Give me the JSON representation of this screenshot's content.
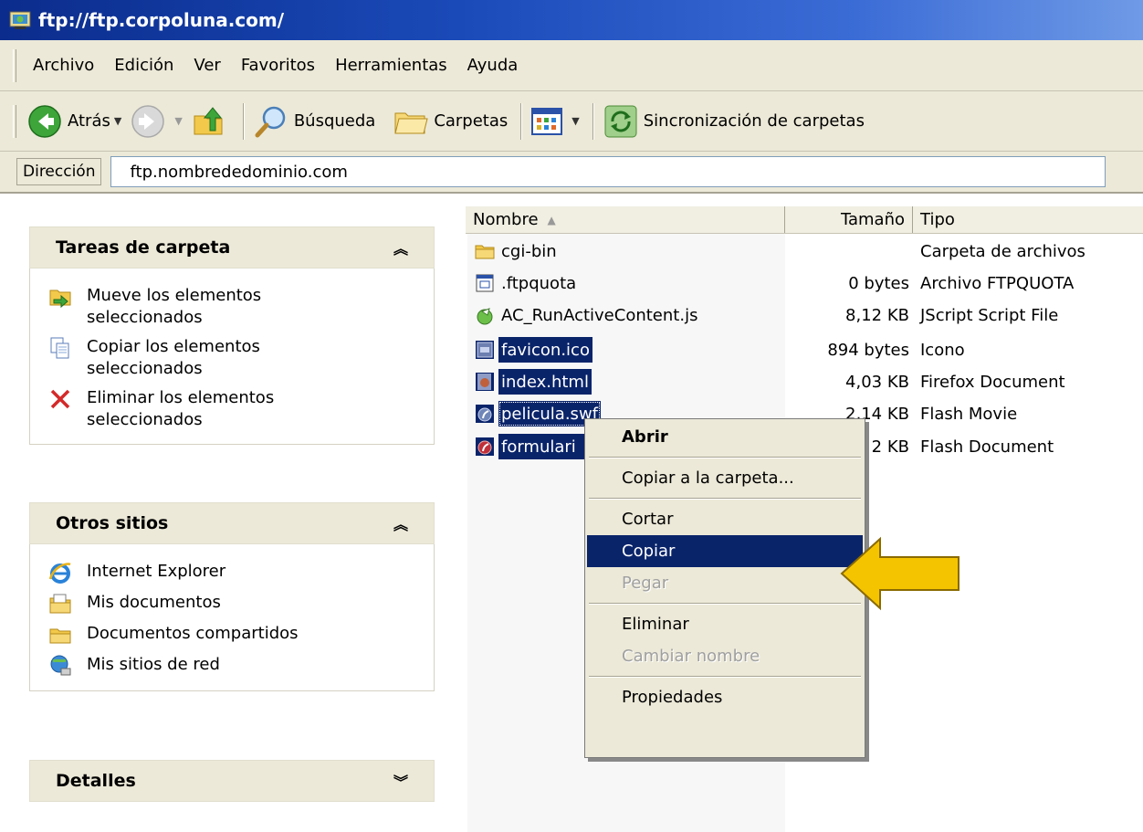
{
  "window": {
    "title": "ftp://ftp.corpoluna.com/"
  },
  "menubar": {
    "items": [
      "Archivo",
      "Edición",
      "Ver",
      "Favoritos",
      "Herramientas",
      "Ayuda"
    ]
  },
  "toolbar": {
    "back_label": "Atrás",
    "search_label": "Búsqueda",
    "folders_label": "Carpetas",
    "sync_label": "Sincronización de carpetas"
  },
  "address": {
    "label": "Dirección",
    "value": "ftp.nombrededominio.com"
  },
  "taskpane": {
    "folder_tasks": {
      "title": "Tareas de carpeta",
      "items": [
        {
          "line1": "Mueve los elementos",
          "line2": "seleccionados"
        },
        {
          "line1": "Copiar los elementos",
          "line2": "seleccionados"
        },
        {
          "line1": "Eliminar los elementos",
          "line2": "seleccionados"
        }
      ]
    },
    "other_places": {
      "title": "Otros sitios",
      "items": [
        "Internet Explorer",
        "Mis documentos",
        "Documentos compartidos",
        "Mis sitios de red"
      ]
    },
    "details": {
      "title": "Detalles"
    }
  },
  "filelist": {
    "columns": {
      "name": "Nombre",
      "size": "Tamaño",
      "type": "Tipo"
    },
    "rows": [
      {
        "name": "cgi-bin",
        "size": "",
        "type": "Carpeta de archivos",
        "selected": false
      },
      {
        "name": ".ftpquota",
        "size": "0 bytes",
        "type": "Archivo FTPQUOTA",
        "selected": false
      },
      {
        "name": "AC_RunActiveContent.js",
        "size": "8,12 KB",
        "type": "JScript Script File",
        "selected": false
      },
      {
        "name": "favicon.ico",
        "size": "894 bytes",
        "type": "Icono",
        "selected": true
      },
      {
        "name": "index.html",
        "size": "4,03 KB",
        "type": "Firefox Document",
        "selected": true
      },
      {
        "name": "pelicula.swf",
        "size": "2,14 KB",
        "type": "Flash Movie",
        "selected": true
      },
      {
        "name": "formulari",
        "size": "2 KB",
        "type": "Flash Document",
        "selected": true
      }
    ]
  },
  "context_menu": {
    "open": "Abrir",
    "copy_to_folder": "Copiar a la carpeta...",
    "cut": "Cortar",
    "copy": "Copiar",
    "paste": "Pegar",
    "delete": "Eliminar",
    "rename": "Cambiar nombre",
    "properties": "Propiedades"
  },
  "colors": {
    "selection": "#0a246a",
    "pointer_arrow": "#f5c400",
    "chrome": "#ece9d8"
  }
}
